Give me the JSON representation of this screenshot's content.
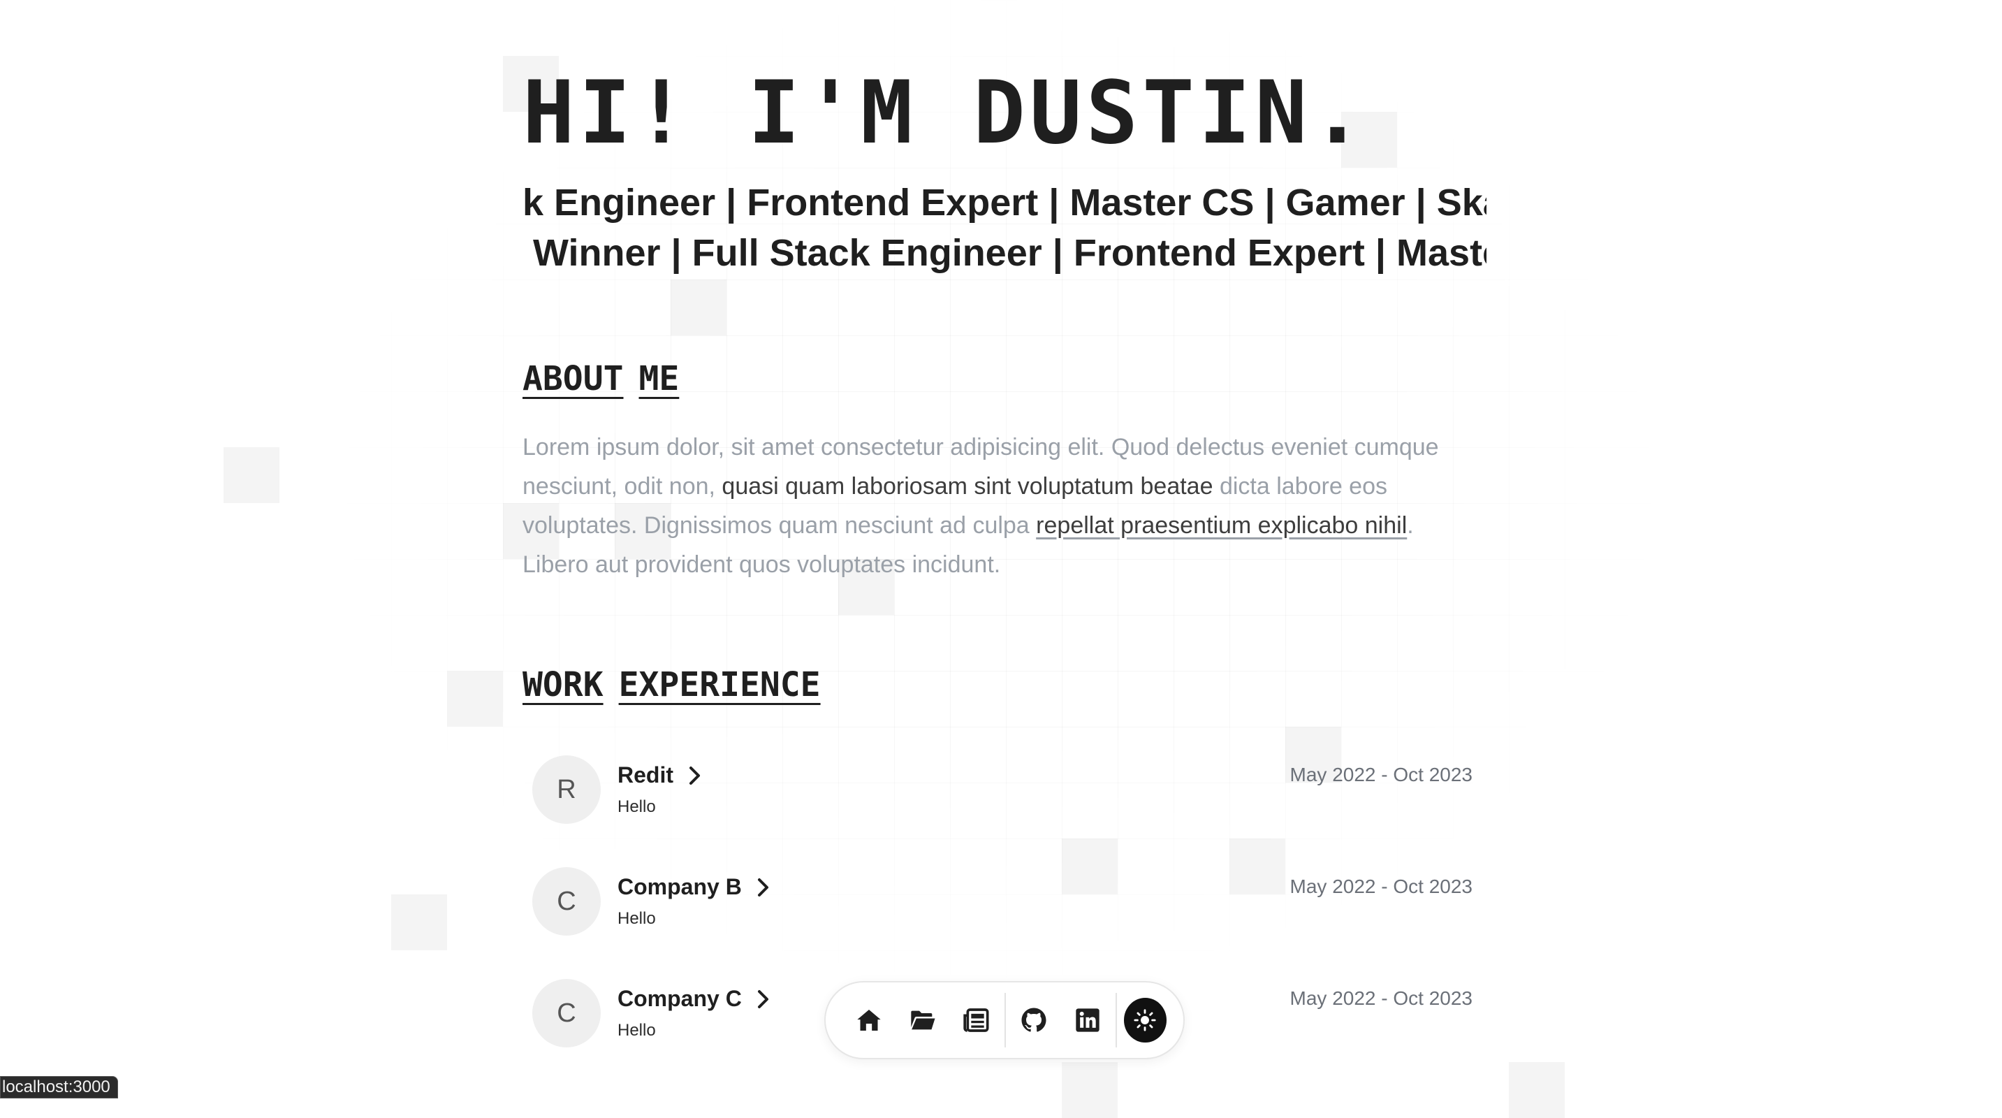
{
  "hero": {
    "title": "HI! I'M DUSTIN.",
    "marquee_line_1": "k Engineer | Frontend Expert | Master CS | Gamer | Skat",
    "marquee_line_2": " Winner | Full Stack Engineer | Frontend Expert | Master"
  },
  "about": {
    "heading_words": [
      "ABOUT",
      "ME"
    ],
    "text_1": "Lorem ipsum dolor, sit amet consectetur adipisicing elit. Quod delectus eveniet cumque nesciunt, odit non, ",
    "text_strong": "quasi quam laboriosam sint voluptatum beatae",
    "text_2": " dicta labore eos voluptates. Dignissimos quam nesciunt ad culpa ",
    "text_link": "repellat praesentium explicabo nihil",
    "text_3": ". Libero aut provident quos voluptates incidunt."
  },
  "work": {
    "heading_words": [
      "WORK",
      "EXPERIENCE"
    ],
    "jobs": [
      {
        "initial": "R",
        "name": "Redit",
        "description": "Hello",
        "dates": "May 2022 - Oct 2023"
      },
      {
        "initial": "C",
        "name": "Company B",
        "description": "Hello",
        "dates": "May 2022 - Oct 2023"
      },
      {
        "initial": "C",
        "name": "Company C",
        "description": "Hello",
        "dates": "May 2022 - Oct 2023"
      }
    ]
  },
  "dock": {
    "icons": [
      "home-icon",
      "folder-open-icon",
      "newspaper-icon",
      "github-icon",
      "linkedin-icon",
      "sun-icon"
    ],
    "theme_button_color": "#111111"
  },
  "status_bar": {
    "url": "localhost:3000"
  }
}
